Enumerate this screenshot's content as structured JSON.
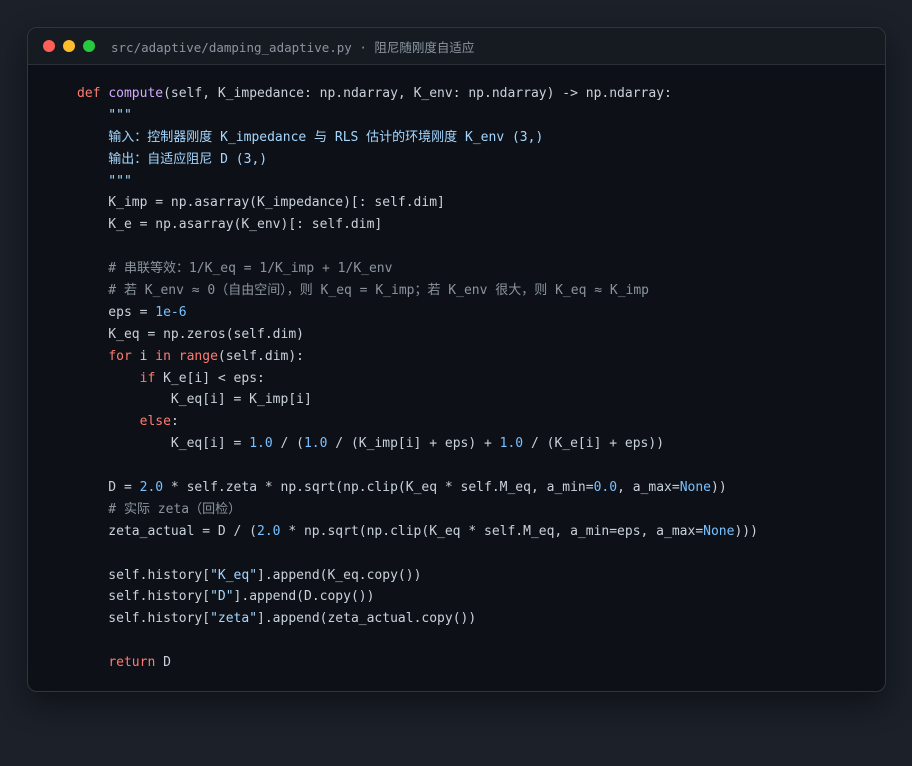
{
  "window": {
    "title": "src/adaptive/damping_adaptive.py · 阻尼随刚度自适应",
    "controls": {
      "close_color": "#ff5f56",
      "minimize_color": "#ffbd2e",
      "maximize_color": "#27c93f"
    }
  },
  "theme": {
    "page_background": "#1b2029",
    "window_background": "#0d1117",
    "titlebar_background": "#161b22",
    "keyword": "#ff7b72",
    "function": "#d2a8ff",
    "number": "#79c0ff",
    "string": "#a5d6ff",
    "comment": "#8b949e",
    "text": "#c9d1d9"
  },
  "code_lines": [
    [
      {
        "t": "kw",
        "v": "def "
      },
      {
        "t": "fn",
        "v": "compute"
      },
      {
        "t": "plain",
        "v": "(self, K_impedance: np.ndarray, K_env: np.ndarray) -> np.ndarray:"
      }
    ],
    [
      {
        "t": "doc",
        "v": "    \"\"\""
      }
    ],
    [
      {
        "t": "doc",
        "v": "    输入：控制器刚度 K_impedance 与 RLS 估计的环境刚度 K_env (3,)"
      }
    ],
    [
      {
        "t": "doc",
        "v": "    输出：自适应阻尼 D (3,)"
      }
    ],
    [
      {
        "t": "doc",
        "v": "    \"\"\""
      }
    ],
    [
      {
        "t": "plain",
        "v": "    K_imp = np.asarray(K_impedance)[: self.dim]"
      }
    ],
    [
      {
        "t": "plain",
        "v": "    K_e = np.asarray(K_env)[: self.dim]"
      }
    ],
    [
      {
        "t": "plain",
        "v": ""
      }
    ],
    [
      {
        "t": "cm",
        "v": "    # 串联等效：1/K_eq = 1/K_imp + 1/K_env"
      }
    ],
    [
      {
        "t": "cm",
        "v": "    # 若 K_env ≈ 0（自由空间），则 K_eq = K_imp；若 K_env 很大，则 K_eq ≈ K_imp"
      }
    ],
    [
      {
        "t": "plain",
        "v": "    eps = "
      },
      {
        "t": "num",
        "v": "1e-6"
      }
    ],
    [
      {
        "t": "plain",
        "v": "    K_eq = np.zeros(self.dim)"
      }
    ],
    [
      {
        "t": "plain",
        "v": "    "
      },
      {
        "t": "kw",
        "v": "for"
      },
      {
        "t": "plain",
        "v": " i "
      },
      {
        "t": "kw",
        "v": "in"
      },
      {
        "t": "plain",
        "v": " "
      },
      {
        "t": "kw",
        "v": "range"
      },
      {
        "t": "plain",
        "v": "(self.dim):"
      }
    ],
    [
      {
        "t": "plain",
        "v": "        "
      },
      {
        "t": "kw",
        "v": "if"
      },
      {
        "t": "plain",
        "v": " K_e[i] < eps:"
      }
    ],
    [
      {
        "t": "plain",
        "v": "            K_eq[i] = K_imp[i]"
      }
    ],
    [
      {
        "t": "plain",
        "v": "        "
      },
      {
        "t": "kw",
        "v": "else"
      },
      {
        "t": "plain",
        "v": ":"
      }
    ],
    [
      {
        "t": "plain",
        "v": "            K_eq[i] = "
      },
      {
        "t": "num",
        "v": "1.0"
      },
      {
        "t": "plain",
        "v": " / ("
      },
      {
        "t": "num",
        "v": "1.0"
      },
      {
        "t": "plain",
        "v": " / (K_imp[i] + eps) + "
      },
      {
        "t": "num",
        "v": "1.0"
      },
      {
        "t": "plain",
        "v": " / (K_e[i] + eps))"
      }
    ],
    [
      {
        "t": "plain",
        "v": ""
      }
    ],
    [
      {
        "t": "plain",
        "v": "    D = "
      },
      {
        "t": "num",
        "v": "2.0"
      },
      {
        "t": "plain",
        "v": " * self.zeta * np.sqrt(np.clip(K_eq * self.M_eq, a_min="
      },
      {
        "t": "num",
        "v": "0.0"
      },
      {
        "t": "plain",
        "v": ", a_max="
      },
      {
        "t": "num",
        "v": "None"
      },
      {
        "t": "plain",
        "v": "))"
      }
    ],
    [
      {
        "t": "cm",
        "v": "    # 实际 zeta（回检）"
      }
    ],
    [
      {
        "t": "plain",
        "v": "    zeta_actual = D / ("
      },
      {
        "t": "num",
        "v": "2.0"
      },
      {
        "t": "plain",
        "v": " * np.sqrt(np.clip(K_eq * self.M_eq, a_min=eps, a_max="
      },
      {
        "t": "num",
        "v": "None"
      },
      {
        "t": "plain",
        "v": ")))"
      }
    ],
    [
      {
        "t": "plain",
        "v": ""
      }
    ],
    [
      {
        "t": "plain",
        "v": "    self.history["
      },
      {
        "t": "str",
        "v": "\"K_eq\""
      },
      {
        "t": "plain",
        "v": "].append(K_eq.copy())"
      }
    ],
    [
      {
        "t": "plain",
        "v": "    self.history["
      },
      {
        "t": "str",
        "v": "\"D\""
      },
      {
        "t": "plain",
        "v": "].append(D.copy())"
      }
    ],
    [
      {
        "t": "plain",
        "v": "    self.history["
      },
      {
        "t": "str",
        "v": "\"zeta\""
      },
      {
        "t": "plain",
        "v": "].append(zeta_actual.copy())"
      }
    ],
    [
      {
        "t": "plain",
        "v": ""
      }
    ],
    [
      {
        "t": "plain",
        "v": "    "
      },
      {
        "t": "kw",
        "v": "return"
      },
      {
        "t": "plain",
        "v": " D"
      }
    ]
  ]
}
